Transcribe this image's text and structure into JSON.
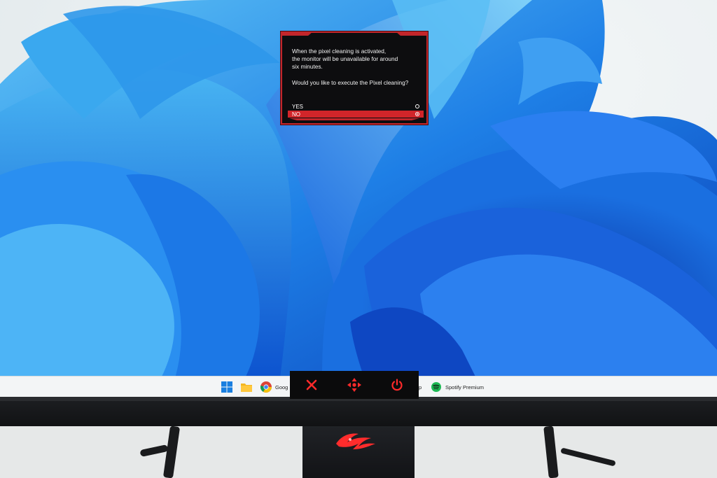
{
  "osd": {
    "message_lines": [
      "When the pixel cleaning is activated,",
      "the monitor will be unavailable for around",
      "six minutes."
    ],
    "question": "Would you like to execute the Pixel cleaning?",
    "options": [
      {
        "label": "YES",
        "selected": false
      },
      {
        "label": "NO",
        "selected": true
      }
    ],
    "accent_color": "#d1252a"
  },
  "taskbar": {
    "items": [
      {
        "icon": "windows-start-icon",
        "label": ""
      },
      {
        "icon": "file-explorer-icon",
        "label": ""
      },
      {
        "icon": "chrome-icon",
        "label": "Goog"
      },
      {
        "icon": "app-icon",
        "label": "p"
      },
      {
        "icon": "spotify-icon",
        "label": "Spotify Premium"
      }
    ]
  },
  "monitor_keys": [
    {
      "icon": "close-x-icon"
    },
    {
      "icon": "navigation-joystick-icon"
    },
    {
      "icon": "power-icon"
    }
  ],
  "brand_logo": "rog-logo"
}
